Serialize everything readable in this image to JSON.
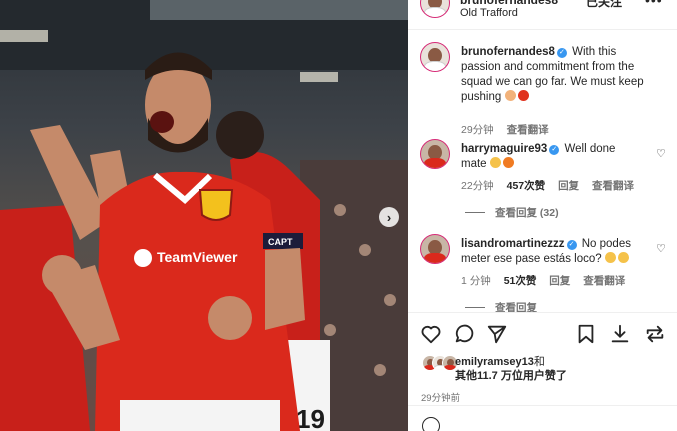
{
  "colors": {
    "brand_red": "#da291c",
    "verified": "#3897f0",
    "muted": "#737373",
    "text": "#262626"
  },
  "post": {
    "photo_text": {
      "sponsor": "TeamViewer",
      "captain_band": "CAPT",
      "shirt_number": "19"
    },
    "next_icon": "chevron-right-icon"
  },
  "header": {
    "username": "brunofernandes8",
    "follow_label": "已关注",
    "location": "Old Trafford",
    "more_icon": "more-horizontal-icon"
  },
  "comments": [
    {
      "username": "brunofernandes8",
      "text_line1": "With this",
      "text_line2": "passion and commitment from the",
      "text_line3": "squad we can go far. We must keep",
      "text_line4": "pushing",
      "time": "29分钟",
      "translate": "查看翻译"
    },
    {
      "username": "harrymaguire93",
      "text": "Well done",
      "text_line2": "mate",
      "time": "22分钟",
      "likes": "457次赞",
      "reply": "回复",
      "translate": "查看翻译",
      "view_replies": "查看回复 (32)"
    },
    {
      "username": "lisandromartinezzz",
      "text": "No podes",
      "text_line2": "meter ese pase estás loco?",
      "time": "1 分钟",
      "likes": "51次赞",
      "reply": "回复",
      "translate": "查看翻译",
      "view_replies_partial": "查看回复"
    }
  ],
  "actions": {
    "like_icon": "heart-icon",
    "comment_icon": "comment-icon",
    "share_icon": "send-icon",
    "save_icon": "bookmark-icon",
    "download_icon": "download-icon",
    "repost_icon": "repost-icon"
  },
  "likes": {
    "first_user": "emilyramsey13",
    "connector": "和",
    "others_line": "其他11.7 万位用户赞了"
  },
  "timestamp": "29分钟前"
}
